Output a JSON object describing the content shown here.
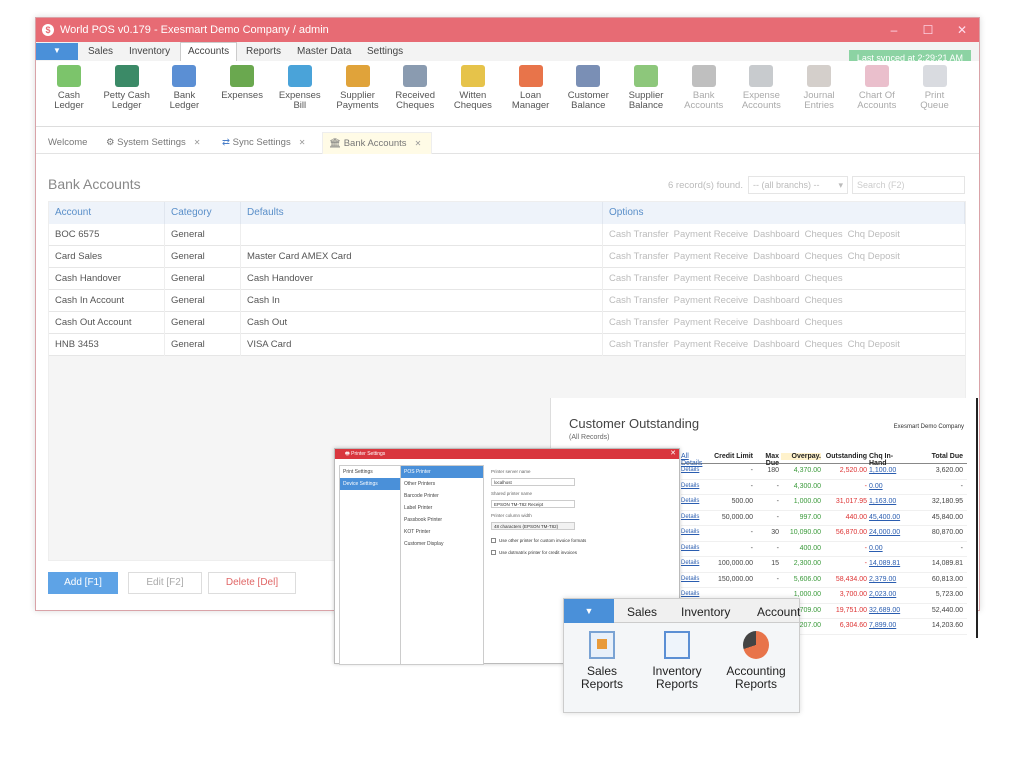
{
  "window": {
    "title": "World POS v0.179 - Exesmart Demo Company / admin"
  },
  "menu": {
    "tabs": [
      "Sales",
      "Inventory",
      "Accounts",
      "Reports",
      "Master Data",
      "Settings"
    ],
    "active": "Accounts"
  },
  "sync_status": "Last synced at 2:29:21 AM",
  "ribbon": [
    {
      "label1": "Cash",
      "label2": "Ledger",
      "icon": "cash-ledger-icon",
      "color": "#7cc46b"
    },
    {
      "label1": "Petty Cash",
      "label2": "Ledger",
      "icon": "petty-cash-icon",
      "color": "#3b8a67"
    },
    {
      "label1": "Bank",
      "label2": "Ledger",
      "icon": "bank-ledger-icon",
      "color": "#5b8fd4"
    },
    {
      "label1": "Expenses",
      "label2": "",
      "icon": "expenses-icon",
      "color": "#6aa84f"
    },
    {
      "label1": "Expenses",
      "label2": "Bill",
      "icon": "expenses-bill-icon",
      "color": "#4aa3d9"
    },
    {
      "label1": "Supplier",
      "label2": "Payments",
      "icon": "supplier-payments-icon",
      "color": "#e0a33a"
    },
    {
      "label1": "Received",
      "label2": "Cheques",
      "icon": "received-cheques-icon",
      "color": "#8a9bb0"
    },
    {
      "label1": "Witten",
      "label2": "Cheques",
      "icon": "written-cheques-icon",
      "color": "#e6c34a"
    },
    {
      "label1": "Loan",
      "label2": "Manager",
      "icon": "loan-manager-icon",
      "color": "#e8744a"
    },
    {
      "label1": "Customer",
      "label2": "Balance",
      "icon": "customer-balance-icon",
      "color": "#7a8fb5"
    },
    {
      "label1": "Supplier",
      "label2": "Balance",
      "icon": "supplier-balance-icon",
      "color": "#8dc77b"
    },
    {
      "label1": "Bank",
      "label2": "Accounts",
      "icon": "bank-accounts-icon",
      "color": "#8a8a8a"
    },
    {
      "label1": "Expense",
      "label2": "Accounts",
      "icon": "expense-accounts-icon",
      "color": "#9aa0a6"
    },
    {
      "label1": "Journal",
      "label2": "Entries",
      "icon": "journal-entries-icon",
      "color": "#b0a8a0"
    },
    {
      "label1": "Chart Of",
      "label2": "Accounts",
      "icon": "chart-of-accounts-icon",
      "color": "#d98aa3"
    },
    {
      "label1": "Print",
      "label2": "Queue",
      "icon": "print-queue-icon",
      "color": "#b9bec6"
    }
  ],
  "doc_tabs": [
    "Welcome",
    "System Settings",
    "Sync Settings",
    "Bank Accounts"
  ],
  "page": {
    "title": "Bank Accounts",
    "records": "6 record(s) found.",
    "branch_filter": "-- (all branchs) --",
    "search_placeholder": "Search (F2)"
  },
  "grid": {
    "headers": [
      "Account",
      "Category",
      "Defaults",
      "Options"
    ],
    "rows": [
      {
        "account": "BOC 6575",
        "category": "General",
        "defaults": "",
        "options": [
          "Cash Transfer",
          "Payment Receive",
          "Dashboard",
          "Cheques",
          "Chq Deposit"
        ]
      },
      {
        "account": "Card Sales",
        "category": "General",
        "defaults": "Master Card  AMEX Card",
        "options": [
          "Cash Transfer",
          "Payment Receive",
          "Dashboard",
          "Cheques",
          "Chq Deposit"
        ]
      },
      {
        "account": "Cash Handover",
        "category": "General",
        "defaults": "Cash Handover",
        "options": [
          "Cash Transfer",
          "Payment Receive",
          "Dashboard",
          "Cheques"
        ]
      },
      {
        "account": "Cash In Account",
        "category": "General",
        "defaults": "Cash In",
        "options": [
          "Cash Transfer",
          "Payment Receive",
          "Dashboard",
          "Cheques"
        ]
      },
      {
        "account": "Cash Out Account",
        "category": "General",
        "defaults": "Cash Out",
        "options": [
          "Cash Transfer",
          "Payment Receive",
          "Dashboard",
          "Cheques"
        ]
      },
      {
        "account": "HNB 3453",
        "category": "General",
        "defaults": "VISA Card",
        "options": [
          "Cash Transfer",
          "Payment Receive",
          "Dashboard",
          "Cheques",
          "Chq Deposit"
        ]
      }
    ]
  },
  "buttons": {
    "add": "Add [F1]",
    "edit": "Edit [F2]",
    "delete": "Delete [Del]"
  },
  "customer_outstanding": {
    "title": "Customer Outstanding",
    "subtitle": "(All Records)",
    "company": "Exesmart Demo Company",
    "headers": [
      "All Details",
      "Credit Limit",
      "Max Due",
      "Overpay.",
      "Outstanding",
      "Chq In-Hand",
      "Total Due"
    ],
    "rows": [
      [
        "Details",
        "-",
        "180",
        "4,370.00",
        "2,520.00",
        "1,100.00",
        "3,620.00"
      ],
      [
        "Details",
        "-",
        "-",
        "4,300.00",
        "-",
        "0.00",
        "-"
      ],
      [
        "Details",
        "500.00",
        "-",
        "1,000.00",
        "31,017.95",
        "1,163.00",
        "32,180.95"
      ],
      [
        "Details",
        "50,000.00",
        "-",
        "997.00",
        "440.00",
        "45,400.00",
        "45,840.00"
      ],
      [
        "Details",
        "-",
        "30",
        "10,090.00",
        "56,870.00",
        "24,000.00",
        "80,870.00"
      ],
      [
        "Details",
        "-",
        "-",
        "400.00",
        "-",
        "0.00",
        "-"
      ],
      [
        "Details",
        "100,000.00",
        "15",
        "2,300.00",
        "-",
        "14,089.81",
        "14,089.81"
      ],
      [
        "Details",
        "150,000.00",
        "-",
        "5,606.00",
        "58,434.00",
        "2,379.00",
        "60,813.00"
      ],
      [
        "Details",
        "",
        "",
        "1,000.00",
        "3,700.00",
        "2,023.00",
        "5,723.00"
      ],
      [
        "",
        "",
        "",
        "709.00",
        "19,751.00",
        "32,689.00",
        "52,440.00"
      ],
      [
        "",
        "",
        "",
        "207.00",
        "6,304.60",
        "7,899.00",
        "14,203.60"
      ]
    ]
  },
  "printer_settings": {
    "title": "Printer Settings",
    "left_items": [
      "Print Settings",
      "Device Settings"
    ],
    "mid_items": [
      "POS Printer",
      "Other Printers",
      "Barcode Printer",
      "Label Printer",
      "Passbook Printer",
      "KOT Printer",
      "Customer Display"
    ],
    "server_label": "Printer server name",
    "server_value": "localhost",
    "shared_label": "Shared printer name",
    "shared_value": "EPSON TM-T82 Receipt",
    "width_label": "Printer column width",
    "width_value": "48 characters (EPSON TM-T82)",
    "check1": "Use other printer for custom invoice formats",
    "check2": "Use dotmatrix printer for credit invoices"
  },
  "reports_ribbon": {
    "tabs": [
      "Sales",
      "Inventory",
      "Account"
    ],
    "items": [
      {
        "label1": "Sales",
        "label2": "Reports",
        "icon": "sales-reports-icon"
      },
      {
        "label1": "Inventory",
        "label2": "Reports",
        "icon": "inventory-reports-icon"
      },
      {
        "label1": "Accounting",
        "label2": "Reports",
        "icon": "accounting-reports-icon"
      }
    ]
  }
}
